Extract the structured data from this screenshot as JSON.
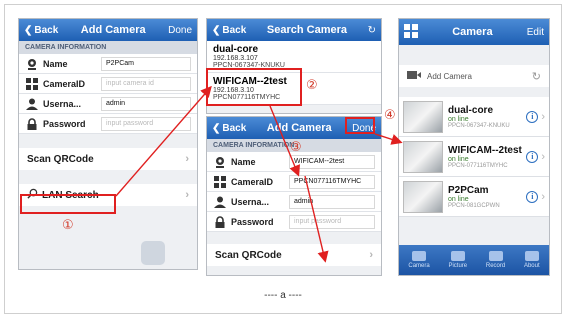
{
  "screen1": {
    "back": "Back",
    "title": "Add Camera",
    "done": "Done",
    "section": "CAMERA INFORMATION",
    "fields": [
      {
        "label": "Name",
        "value": "P2PCam",
        "placeholder": ""
      },
      {
        "label": "CameraID",
        "value": "",
        "placeholder": "input camera id"
      },
      {
        "label": "Userna...",
        "value": "admin",
        "placeholder": ""
      },
      {
        "label": "Password",
        "value": "",
        "placeholder": "input password"
      }
    ],
    "scan": "Scan QRCode",
    "lan": "LAN Search"
  },
  "screen2": {
    "back": "Back",
    "title": "Search Camera",
    "devices": [
      {
        "name": "dual-core",
        "ip": "192.168.3.107",
        "id": "PPCN-067347-KNUKU"
      },
      {
        "name": "WIFICAM--2test",
        "ip": "192.168.3.10",
        "id": "PPCN077116TMYHC"
      }
    ]
  },
  "screen3": {
    "back": "Back",
    "title": "Add Camera",
    "done": "Done",
    "section": "CAMERA INFORMATION",
    "fields": [
      {
        "label": "Name",
        "value": "WIFICAM--2test",
        "placeholder": ""
      },
      {
        "label": "CameraID",
        "value": "PPCN077116TMYHC",
        "placeholder": ""
      },
      {
        "label": "Userna...",
        "value": "admin",
        "placeholder": ""
      },
      {
        "label": "Password",
        "value": "",
        "placeholder": "input password"
      }
    ],
    "scan": "Scan QRCode"
  },
  "screen4": {
    "title": "Camera",
    "edit": "Edit",
    "add": "Add Camera",
    "cameras": [
      {
        "name": "dual-core",
        "status": "on line",
        "id": "PPCN-067347-KNUKU"
      },
      {
        "name": "WIFICAM--2test",
        "status": "on line",
        "id": "PPCN-077116TMYHC"
      },
      {
        "name": "P2PCam",
        "status": "on line",
        "id": "PPCN-081GCPWN"
      }
    ],
    "tabs": [
      "Camera",
      "Picture",
      "Record",
      "About"
    ]
  },
  "steps": [
    "①",
    "②",
    "③",
    "④"
  ],
  "caption": "---- a ----",
  "colors": {
    "nav": "#1e5fb3",
    "highlight": "#e02020"
  }
}
